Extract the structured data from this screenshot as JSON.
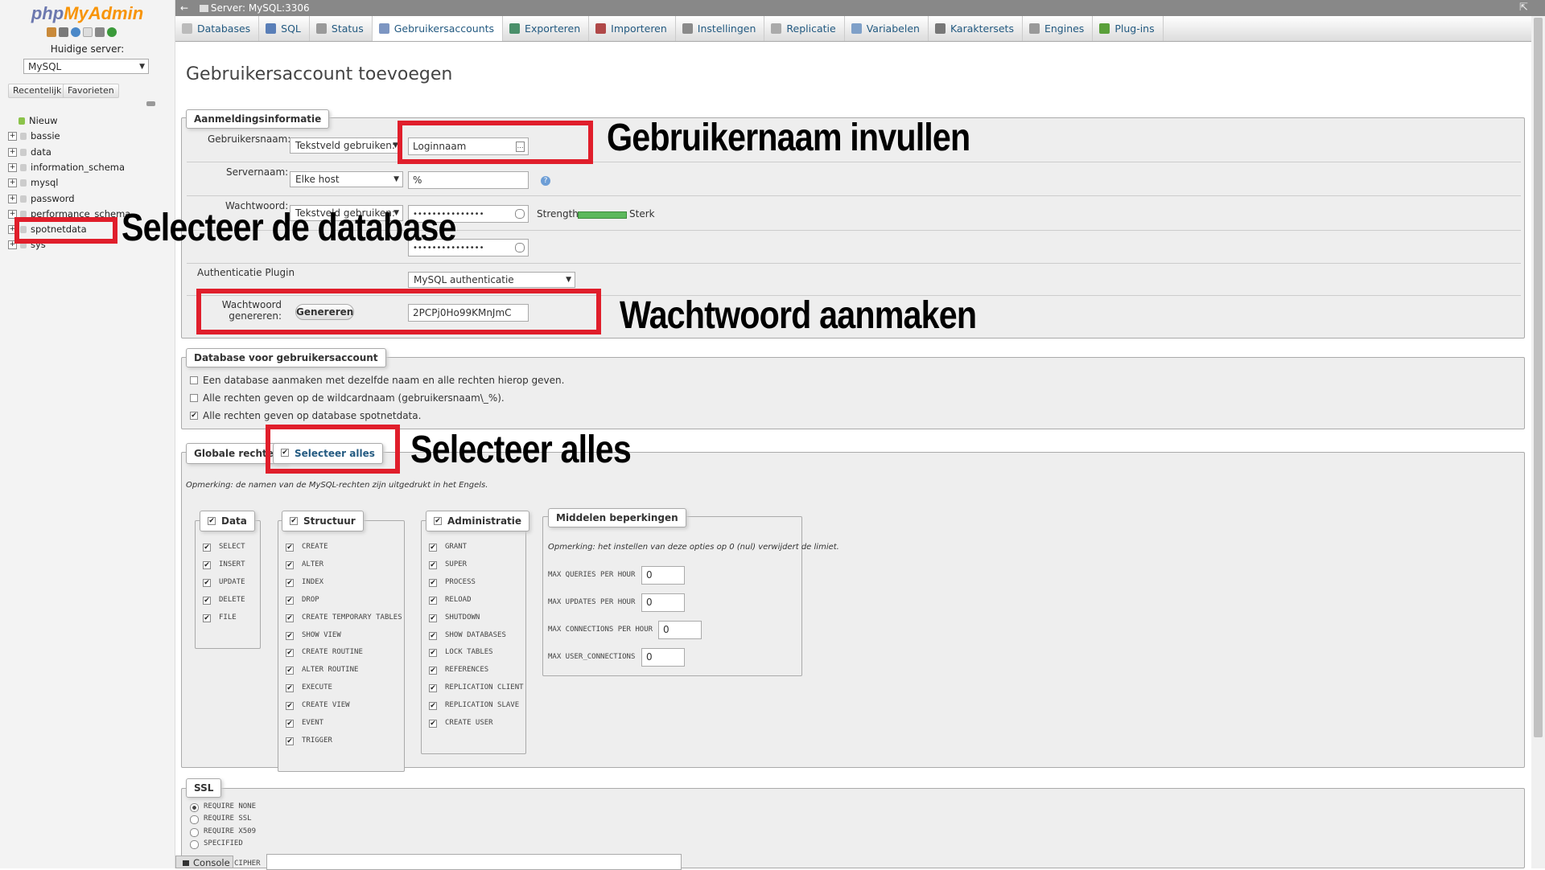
{
  "sidebar": {
    "logo_php": "php",
    "logo_myadmin": "MyAdmin",
    "server_label": "Huidige server:",
    "server_value": "MySQL",
    "recent_label": "Recentelijk",
    "favorites_label": "Favorieten",
    "tree": [
      "Nieuw",
      "bassie",
      "data",
      "information_schema",
      "mysql",
      "password",
      "performance_schema",
      "spotnetdata",
      "sys"
    ]
  },
  "topbar": {
    "title": "Server: MySQL:3306"
  },
  "tabs": [
    "Databases",
    "SQL",
    "Status",
    "Gebruikersaccounts",
    "Exporteren",
    "Importeren",
    "Instellingen",
    "Replicatie",
    "Variabelen",
    "Karaktersets",
    "Engines",
    "Plug-ins"
  ],
  "page_title": "Gebruikersaccount toevoegen",
  "login": {
    "legend": "Aanmeldingsinformatie",
    "username_label": "Gebruikersnaam:",
    "username_mode": "Tekstveld gebruiken:",
    "username_value": "Loginnaam",
    "host_label": "Servernaam:",
    "host_mode": "Elke host",
    "host_value": "%",
    "password_label": "Wachtwoord:",
    "password_mode": "Tekstveld gebruiken:",
    "password_dots": "•••••••••••••••",
    "strength_label": "Strength:",
    "strength_value": "Sterk",
    "auth_label": "Authenticatie Plugin",
    "auth_value": "MySQL authenticatie",
    "generate_label_1": "Wachtwoord",
    "generate_label_2": "genereren:",
    "generate_button": "Genereren",
    "generated_password": "2PCPj0Ho99KMnJmC"
  },
  "database": {
    "legend": "Database voor gebruikersaccount",
    "options": [
      {
        "label": "Een database aanmaken met dezelfde naam en alle rechten hierop geven.",
        "checked": false
      },
      {
        "label": "Alle rechten geven op de wildcardnaam (gebruikersnaam\\_%).",
        "checked": false
      },
      {
        "label": "Alle rechten geven op database spotnetdata.",
        "checked": true
      }
    ]
  },
  "global": {
    "legend": "Globale rechten",
    "select_all": "Selecteer alles",
    "note": "Opmerking: de namen van de MySQL-rechten zijn uitgedrukt in het Engels.",
    "groups": [
      {
        "name": "Data",
        "items": [
          "SELECT",
          "INSERT",
          "UPDATE",
          "DELETE",
          "FILE"
        ]
      },
      {
        "name": "Structuur",
        "items": [
          "CREATE",
          "ALTER",
          "INDEX",
          "DROP",
          "CREATE TEMPORARY TABLES",
          "SHOW VIEW",
          "CREATE ROUTINE",
          "ALTER ROUTINE",
          "EXECUTE",
          "CREATE VIEW",
          "EVENT",
          "TRIGGER"
        ]
      },
      {
        "name": "Administratie",
        "items": [
          "GRANT",
          "SUPER",
          "PROCESS",
          "RELOAD",
          "SHUTDOWN",
          "SHOW DATABASES",
          "LOCK TABLES",
          "REFERENCES",
          "REPLICATION CLIENT",
          "REPLICATION SLAVE",
          "CREATE USER"
        ]
      }
    ],
    "limits": {
      "legend": "Middelen beperkingen",
      "note": "Opmerking: het instellen van deze opties op 0 (nul) verwijdert de limiet.",
      "rows": [
        {
          "label": "MAX QUERIES PER HOUR",
          "value": "0"
        },
        {
          "label": "MAX UPDATES PER HOUR",
          "value": "0"
        },
        {
          "label": "MAX CONNECTIONS PER HOUR",
          "value": "0"
        },
        {
          "label": "MAX USER_CONNECTIONS",
          "value": "0"
        }
      ]
    }
  },
  "ssl": {
    "legend": "SSL",
    "options": [
      "REQUIRE NONE",
      "REQUIRE SSL",
      "REQUIRE X509",
      "SPECIFIED"
    ],
    "selected": "REQUIRE NONE",
    "cipher_label": "CIPHER"
  },
  "console_label": "Console",
  "annotations": {
    "username": "Gebruikernaam invullen",
    "database": "Selecteer de database",
    "password": "Wachtwoord aanmaken",
    "select_all": "Selecteer alles"
  },
  "colors": {
    "annotation_box": "#e01e2b",
    "link": "#235a81",
    "strength_bar": "#5cb85c"
  }
}
